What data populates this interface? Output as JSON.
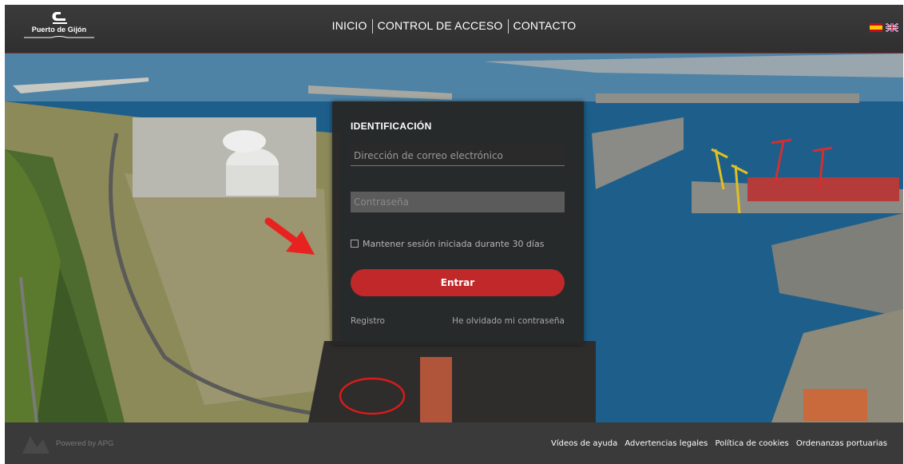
{
  "header": {
    "logo_text": "Puerto de Gijón",
    "nav": [
      "INICIO",
      "CONTROL DE ACCESO",
      "CONTACTO"
    ],
    "languages": [
      "es",
      "en"
    ]
  },
  "login": {
    "title": "IDENTIFICACIÓN",
    "email_placeholder": "Dirección de correo electrónico",
    "password_placeholder": "Contraseña",
    "remember_label": "Mantener sesión iniciada durante 30 días",
    "submit_label": "Entrar",
    "register_link": "Registro",
    "forgot_link": "He olvidado mi contraseña"
  },
  "footer": {
    "powered": "Powered by APG",
    "links": [
      "Vídeos de ayuda",
      "Advertencias legales",
      "Política de cookies",
      "Ordenanzas portuarias"
    ]
  },
  "colors": {
    "accent": "#c0282a",
    "header_bg": "#333333",
    "panel_bg": "#282828"
  }
}
